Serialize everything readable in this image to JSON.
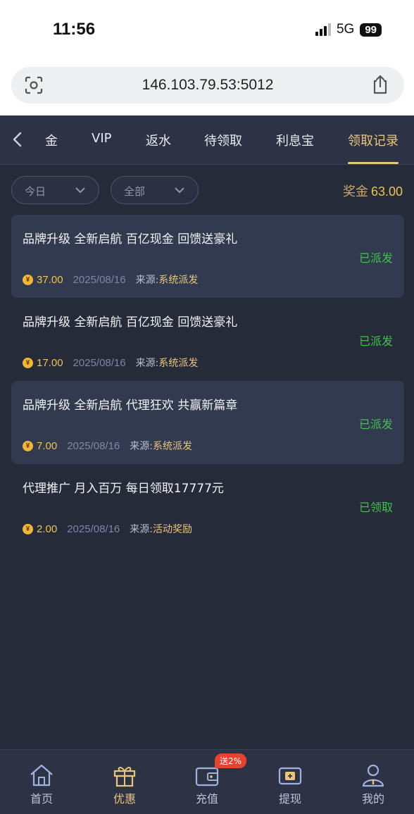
{
  "status_bar": {
    "time": "11:56",
    "network": "5G",
    "battery": "99"
  },
  "browser": {
    "url": "146.103.79.53:5012"
  },
  "tabs": [
    {
      "label": "金"
    },
    {
      "label": "VIP"
    },
    {
      "label": "返水"
    },
    {
      "label": "待领取"
    },
    {
      "label": "利息宝"
    },
    {
      "label": "领取记录"
    }
  ],
  "active_tab": "领取记录",
  "filters": {
    "date": "今日",
    "type": "全部"
  },
  "bonus": {
    "label": "奖金",
    "value": "63.00"
  },
  "records": [
    {
      "title": "品牌升级 全新启航 百亿现金 回馈送豪礼",
      "status": "已派发",
      "amount": "37.00",
      "date": "2025/08/16",
      "source_label": "来源:",
      "source": "系统派发"
    },
    {
      "title": "品牌升级 全新启航 百亿现金 回馈送豪礼",
      "status": "已派发",
      "amount": "17.00",
      "date": "2025/08/16",
      "source_label": "来源:",
      "source": "系统派发"
    },
    {
      "title": "品牌升级 全新启航 代理狂欢 共赢新篇章",
      "status": "已派发",
      "amount": "7.00",
      "date": "2025/08/16",
      "source_label": "来源:",
      "source": "系统派发"
    },
    {
      "title": "代理推广 月入百万 每日领取17777元",
      "status": "已领取",
      "amount": "2.00",
      "date": "2025/08/16",
      "source_label": "来源:",
      "source": "活动奖励"
    }
  ],
  "coin_symbol": "¥",
  "bottom_nav": [
    {
      "label": "首页",
      "icon": "home-icon"
    },
    {
      "label": "优惠",
      "icon": "gift-icon"
    },
    {
      "label": "充值",
      "icon": "wallet-icon"
    },
    {
      "label": "提现",
      "icon": "withdraw-icon"
    },
    {
      "label": "我的",
      "icon": "user-icon"
    }
  ],
  "recharge_badge": "送2%",
  "colors": {
    "accent": "#e9c57a",
    "status_green": "#3fc24c",
    "background": "#262b3a"
  }
}
